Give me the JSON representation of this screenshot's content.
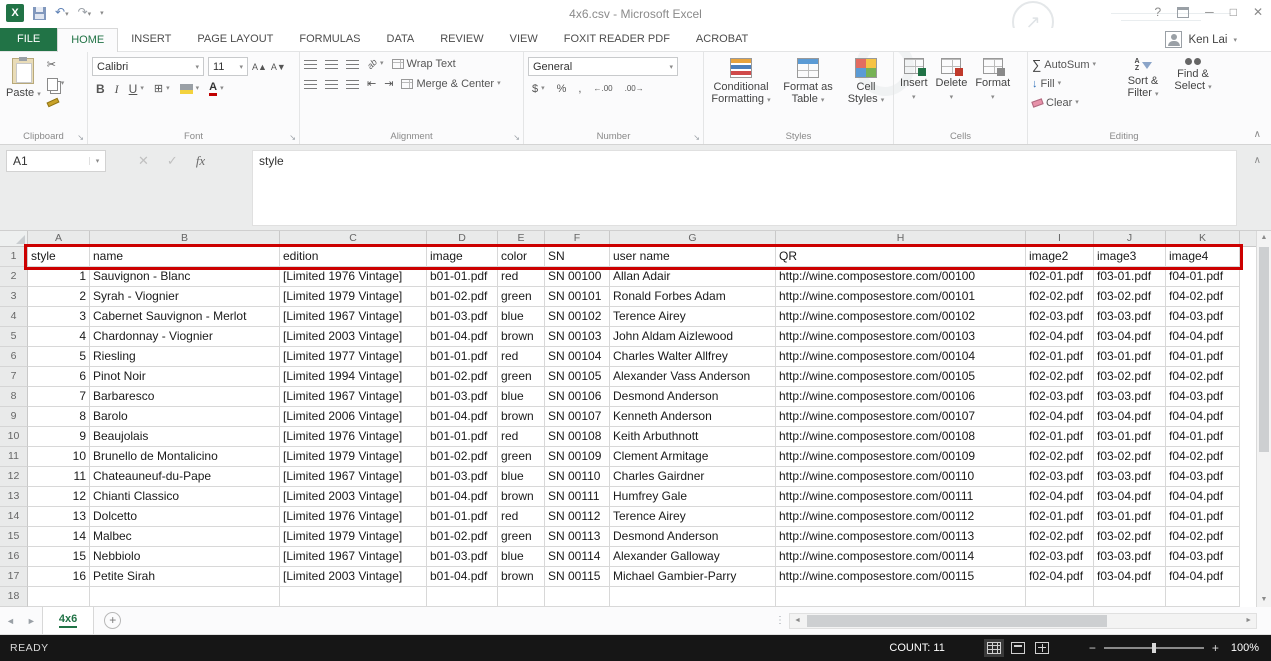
{
  "window": {
    "title": "4x6.csv - Microsoft Excel",
    "user": "Ken Lai"
  },
  "icons": {
    "excel_logo": "X",
    "dropdown": "▾",
    "undo": "↶",
    "redo": "↷",
    "scissors": "✂",
    "check": "✓",
    "cancel": "✕",
    "collapse": "∧",
    "launcher": "↘",
    "up": "▲",
    "down": "▼",
    "left": "◄",
    "right": "►",
    "plus": "+",
    "help": "?",
    "minimize": "─",
    "maximize": "□",
    "close": "✕",
    "grow_font": "A▲",
    "shrink_font": "A▼",
    "borders": "⊞",
    "font_color_letter": "A",
    "orientation": "ab",
    "outdent": "⇤",
    "indent": "⇥",
    "currency": "$",
    "percent": "%",
    "comma": ",",
    "inc_decimal": "←.00",
    "dec_decimal": ".00→",
    "autosum": "∑",
    "fill_arrow": "↓",
    "dots": "⋮",
    "arrow_deco": "↗"
  },
  "ribbon_tabs": {
    "file": "FILE",
    "items": [
      "HOME",
      "INSERT",
      "PAGE LAYOUT",
      "FORMULAS",
      "DATA",
      "REVIEW",
      "VIEW",
      "FOXIT READER PDF",
      "ACROBAT"
    ]
  },
  "ribbon": {
    "clipboard": {
      "group": "Clipboard",
      "paste": "Paste"
    },
    "font": {
      "group": "Font",
      "name": "Calibri",
      "size": "11",
      "bold": "B",
      "italic": "I",
      "underline": "U"
    },
    "alignment": {
      "group": "Alignment",
      "wrap": "Wrap Text",
      "merge": "Merge & Center"
    },
    "number": {
      "group": "Number",
      "format": "General"
    },
    "styles": {
      "group": "Styles",
      "conditional": "Conditional Formatting",
      "table": "Format as Table",
      "cell": "Cell Styles"
    },
    "cells": {
      "group": "Cells",
      "insert": "Insert",
      "delete": "Delete",
      "format": "Format"
    },
    "editing": {
      "group": "Editing",
      "autosum": "AutoSum",
      "fill": "Fill",
      "clear": "Clear",
      "sort": "Sort & Filter",
      "find": "Find & Select"
    }
  },
  "formula": {
    "name_box": "A1",
    "fx": "fx",
    "content": "style"
  },
  "sheet": {
    "column_letters": [
      "A",
      "B",
      "C",
      "D",
      "E",
      "F",
      "G",
      "H",
      "I",
      "J",
      "K"
    ],
    "rows": [
      [
        "style",
        "name",
        "edition",
        "image",
        "color",
        "SN",
        "user name",
        "QR",
        "image2",
        "image3",
        "image4"
      ],
      [
        "1",
        "Sauvignon - Blanc",
        "[Limited 1976 Vintage]",
        "b01-01.pdf",
        "red",
        "SN 00100",
        "Allan Adair",
        "http://wine.composestore.com/00100",
        "f02-01.pdf",
        "f03-01.pdf",
        "f04-01.pdf"
      ],
      [
        "2",
        "Syrah - Viognier",
        "[Limited 1979 Vintage]",
        "b01-02.pdf",
        "green",
        "SN 00101",
        "Ronald Forbes Adam",
        "http://wine.composestore.com/00101",
        "f02-02.pdf",
        "f03-02.pdf",
        "f04-02.pdf"
      ],
      [
        "3",
        "Cabernet Sauvignon - Merlot",
        "[Limited 1967 Vintage]",
        "b01-03.pdf",
        "blue",
        "SN 00102",
        "Terence Airey",
        "http://wine.composestore.com/00102",
        "f02-03.pdf",
        "f03-03.pdf",
        "f04-03.pdf"
      ],
      [
        "4",
        "Chardonnay - Viognier",
        "[Limited 2003 Vintage]",
        "b01-04.pdf",
        "brown",
        "SN 00103",
        "John Aldam Aizlewood",
        "http://wine.composestore.com/00103",
        "f02-04.pdf",
        "f03-04.pdf",
        "f04-04.pdf"
      ],
      [
        "5",
        "Riesling",
        "[Limited 1977 Vintage]",
        "b01-01.pdf",
        "red",
        "SN 00104",
        "Charles Walter Allfrey",
        "http://wine.composestore.com/00104",
        "f02-01.pdf",
        "f03-01.pdf",
        "f04-01.pdf"
      ],
      [
        "6",
        "Pinot Noir",
        "[Limited 1994 Vintage]",
        "b01-02.pdf",
        "green",
        "SN 00105",
        "Alexander Vass Anderson",
        "http://wine.composestore.com/00105",
        "f02-02.pdf",
        "f03-02.pdf",
        "f04-02.pdf"
      ],
      [
        "7",
        "Barbaresco",
        "[Limited 1967 Vintage]",
        "b01-03.pdf",
        "blue",
        "SN 00106",
        "Desmond Anderson",
        "http://wine.composestore.com/00106",
        "f02-03.pdf",
        "f03-03.pdf",
        "f04-03.pdf"
      ],
      [
        "8",
        "Barolo",
        "[Limited 2006 Vintage]",
        "b01-04.pdf",
        "brown",
        "SN 00107",
        "Kenneth Anderson",
        "http://wine.composestore.com/00107",
        "f02-04.pdf",
        "f03-04.pdf",
        "f04-04.pdf"
      ],
      [
        "9",
        "Beaujolais",
        "[Limited 1976 Vintage]",
        "b01-01.pdf",
        "red",
        "SN 00108",
        "Keith Arbuthnott",
        "http://wine.composestore.com/00108",
        "f02-01.pdf",
        "f03-01.pdf",
        "f04-01.pdf"
      ],
      [
        "10",
        "Brunello de Montalicino",
        "[Limited 1979 Vintage]",
        "b01-02.pdf",
        "green",
        "SN 00109",
        "Clement Armitage",
        "http://wine.composestore.com/00109",
        "f02-02.pdf",
        "f03-02.pdf",
        "f04-02.pdf"
      ],
      [
        "11",
        "Chateauneuf-du-Pape",
        "[Limited 1967 Vintage]",
        "b01-03.pdf",
        "blue",
        "SN 00110",
        "Charles Gairdner",
        "http://wine.composestore.com/00110",
        "f02-03.pdf",
        "f03-03.pdf",
        "f04-03.pdf"
      ],
      [
        "12",
        "Chianti Classico",
        "[Limited 2003 Vintage]",
        "b01-04.pdf",
        "brown",
        "SN 00111",
        "Humfrey Gale",
        "http://wine.composestore.com/00111",
        "f02-04.pdf",
        "f03-04.pdf",
        "f04-04.pdf"
      ],
      [
        "13",
        "Dolcetto",
        "[Limited 1976 Vintage]",
        "b01-01.pdf",
        "red",
        "SN 00112",
        "Terence Airey",
        "http://wine.composestore.com/00112",
        "f02-01.pdf",
        "f03-01.pdf",
        "f04-01.pdf"
      ],
      [
        "14",
        "Malbec",
        "[Limited 1979 Vintage]",
        "b01-02.pdf",
        "green",
        "SN 00113",
        "Desmond Anderson",
        "http://wine.composestore.com/00113",
        "f02-02.pdf",
        "f03-02.pdf",
        "f04-02.pdf"
      ],
      [
        "15",
        "Nebbiolo",
        "[Limited 1967 Vintage]",
        "b01-03.pdf",
        "blue",
        "SN 00114",
        "Alexander Galloway",
        "http://wine.composestore.com/00114",
        "f02-03.pdf",
        "f03-03.pdf",
        "f04-03.pdf"
      ],
      [
        "16",
        "Petite Sirah",
        "[Limited 2003 Vintage]",
        "b01-04.pdf",
        "brown",
        "SN 00115",
        "Michael Gambier-Parry",
        "http://wine.composestore.com/00115",
        "f02-04.pdf",
        "f03-04.pdf",
        "f04-04.pdf"
      ],
      [
        "",
        "",
        "",
        "",
        "",
        "",
        "",
        "",
        "",
        "",
        ""
      ]
    ]
  },
  "tabs_strip": {
    "sheet_name": "4x6"
  },
  "status": {
    "mode": "READY",
    "count_label": "COUNT: 11",
    "zoom_level": "100%"
  }
}
